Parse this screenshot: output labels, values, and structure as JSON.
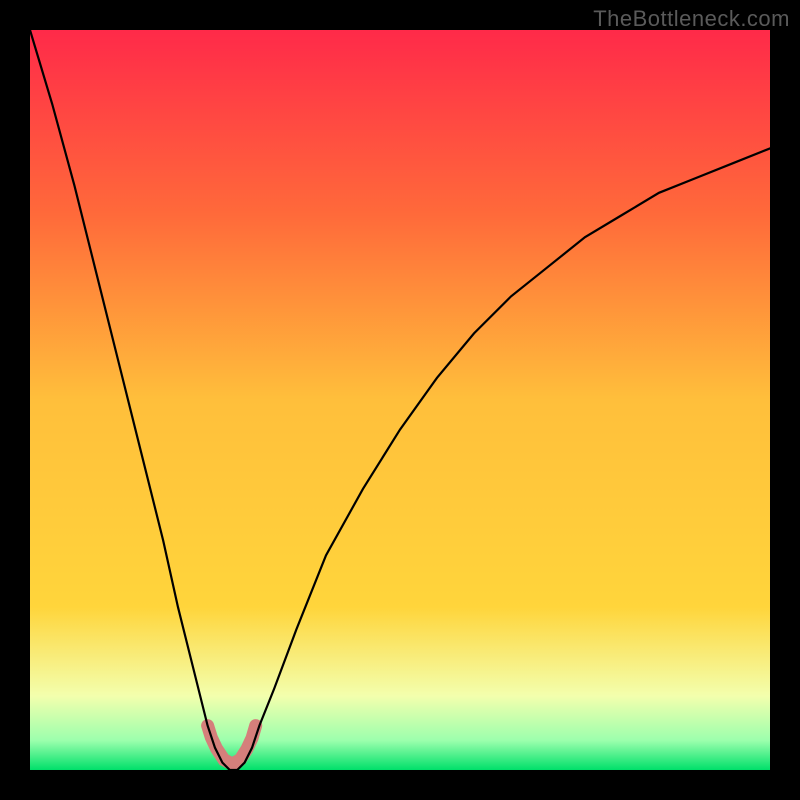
{
  "watermark": "TheBottleneck.com",
  "chart_data": {
    "type": "line",
    "title": "",
    "xlabel": "",
    "ylabel": "",
    "xlim": [
      0,
      100
    ],
    "ylim": [
      0,
      100
    ],
    "grid": false,
    "legend": false,
    "colors": {
      "gradient_top": "#ff2a49",
      "gradient_mid": "#ffd53b",
      "gradient_bottom": "#00e06a",
      "curve": "#000000",
      "optimum_marker": "#d57f7b"
    },
    "optimum_x": 27,
    "series": [
      {
        "name": "bottleneck_percent",
        "x": [
          0,
          3,
          6,
          9,
          12,
          15,
          18,
          20,
          22,
          24,
          25,
          26,
          27,
          28,
          29,
          30,
          31,
          33,
          36,
          40,
          45,
          50,
          55,
          60,
          65,
          70,
          75,
          80,
          85,
          90,
          95,
          100
        ],
        "y": [
          100,
          90,
          79,
          67,
          55,
          43,
          31,
          22,
          14,
          6,
          3,
          1,
          0,
          0,
          1,
          3,
          6,
          11,
          19,
          29,
          38,
          46,
          53,
          59,
          64,
          68,
          72,
          75,
          78,
          80,
          82,
          84
        ]
      }
    ],
    "optimum_marker_points": {
      "x": [
        24.0,
        24.5,
        25.2,
        26.2,
        27.3,
        28.4,
        29.3,
        30.0,
        30.5
      ],
      "y": [
        6.0,
        4.4,
        2.9,
        1.4,
        0.8,
        1.4,
        2.8,
        4.3,
        6.0
      ]
    }
  }
}
